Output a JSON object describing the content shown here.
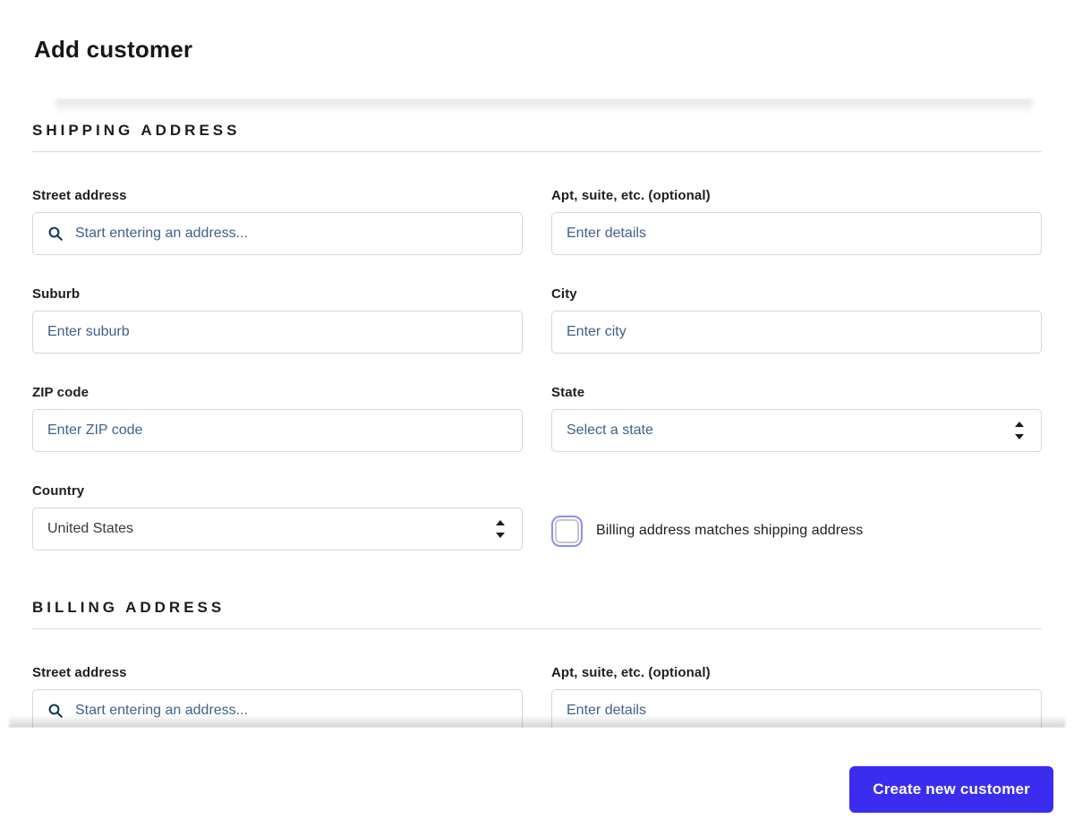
{
  "page": {
    "title": "Add customer"
  },
  "colors": {
    "accent": "#3b2df0",
    "placeholder": "#3f618c",
    "search_icon": "#16365c",
    "checkbox_ring": "#8d8df5",
    "divider": "#d9d9d9"
  },
  "shipping": {
    "section_title": "SHIPPING ADDRESS",
    "fields": {
      "street": {
        "label": "Street address",
        "placeholder": "Start entering an address...",
        "value": ""
      },
      "apt": {
        "label": "Apt, suite, etc. (optional)",
        "placeholder": "Enter details",
        "value": ""
      },
      "suburb": {
        "label": "Suburb",
        "placeholder": "Enter suburb",
        "value": ""
      },
      "city": {
        "label": "City",
        "placeholder": "Enter city",
        "value": ""
      },
      "zip": {
        "label": "ZIP code",
        "placeholder": "Enter ZIP code",
        "value": ""
      },
      "state": {
        "label": "State",
        "value": "Select a state"
      },
      "country": {
        "label": "Country",
        "value": "United States"
      }
    },
    "checkbox": {
      "label": "Billing address matches shipping address",
      "checked": false
    }
  },
  "billing": {
    "section_title": "BILLING ADDRESS",
    "fields": {
      "street": {
        "label": "Street address",
        "placeholder": "Start entering an address...",
        "value": ""
      },
      "apt": {
        "label": "Apt, suite, etc. (optional)",
        "placeholder": "Enter details",
        "value": ""
      }
    }
  },
  "footer": {
    "submit_label": "Create new customer"
  },
  "icons": {
    "search": "magnifying-glass",
    "select_arrows": "up-down-triangles"
  }
}
